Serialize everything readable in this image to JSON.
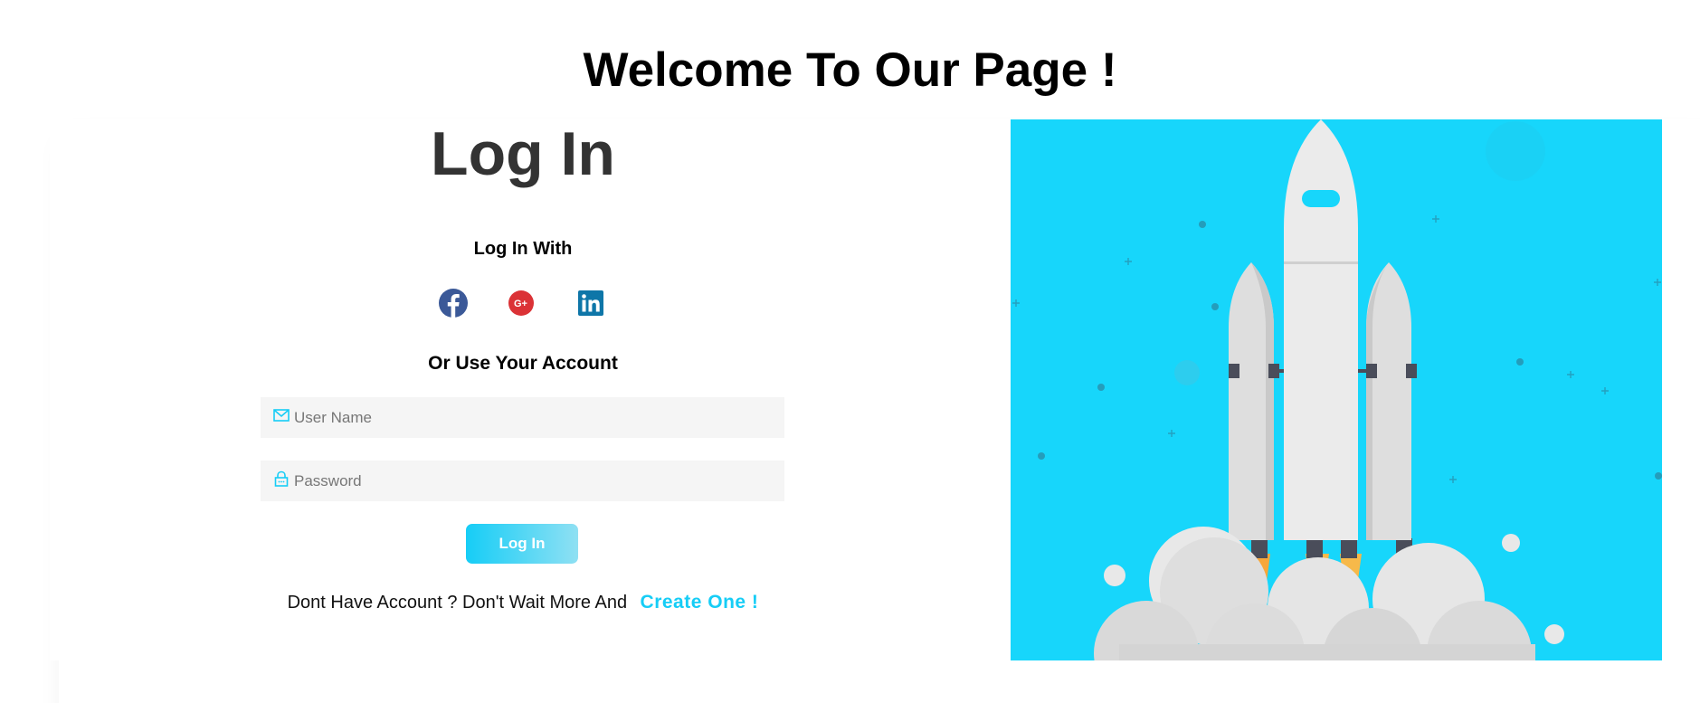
{
  "page": {
    "title": "Welcome To Our Page !"
  },
  "login": {
    "title": "Log In",
    "login_with_label": "Log In With",
    "or_label": "Or Use Your Account",
    "username_placeholder": "User Name",
    "password_placeholder": "Password",
    "submit_label": "Log In",
    "signup_prompt": "Dont Have Account ? Don't Wait More And",
    "signup_link": "Create One !"
  },
  "social": [
    {
      "name": "facebook",
      "icon": "facebook-icon",
      "color": "#3b5998"
    },
    {
      "name": "google-plus",
      "icon": "google-plus-icon",
      "color": "#db3236"
    },
    {
      "name": "linkedin",
      "icon": "linkedin-icon",
      "color": "#0e76a8"
    }
  ],
  "colors": {
    "accent": "#16cdf6",
    "illustration_bg": "#17d6fb",
    "field_bg": "#f5f5f5",
    "title_text": "#333333"
  },
  "illustration": {
    "subject": "rocket-launch-illustration"
  }
}
